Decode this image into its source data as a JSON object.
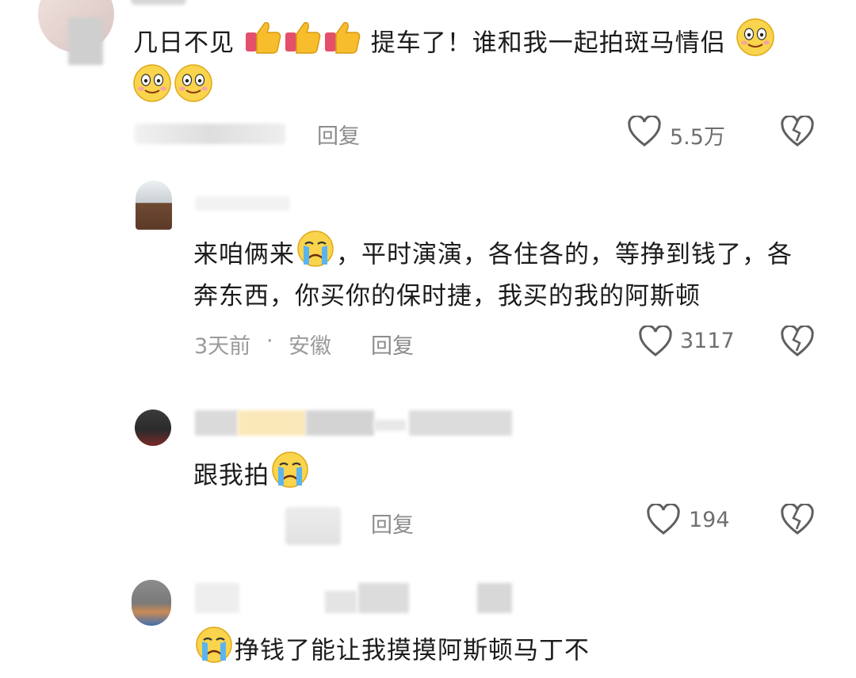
{
  "comments": [
    {
      "text_line1_a": "几日不见",
      "text_line1_b": "提车了！谁和我一起拍斑马情侣",
      "reply_label": "回复",
      "likes": "5.5万"
    },
    {
      "text_line1_a": "来咱俩来",
      "text_line1_b": "，平时演演，各住各的，等挣到钱了，各",
      "text_line2": "奔东西，你买你的保时捷，我买的我的阿斯顿",
      "time": "3天前",
      "separator": "·",
      "location": "安徽",
      "reply_label": "回复",
      "likes": "3117"
    },
    {
      "text": "跟我拍",
      "reply_label": "回复",
      "likes": "194"
    },
    {
      "text_partial": "挣钱了能让我摸摸阿斯顿马丁不"
    }
  ],
  "icons": {
    "like": "heart-outline-icon",
    "dislike": "broken-heart-icon",
    "thumbs": "thumbs-up-emoji",
    "smile": "smile-emoji",
    "cry": "crying-emoji"
  },
  "colors": {
    "text": "#1c1c1c",
    "meta": "#9a9a9a",
    "icon": "#6f6f6f"
  }
}
